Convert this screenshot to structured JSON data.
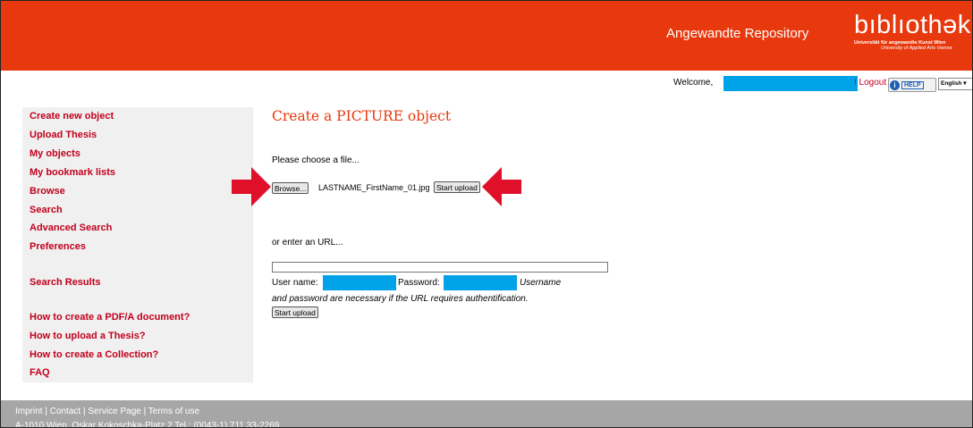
{
  "header": {
    "repository_title": "Angewandte Repository",
    "logo_word": "bıblıothək",
    "logo_sub1": "Universität für angewandte Kunst Wien",
    "logo_sub2": "University of Applied Arts Vienna",
    "brand_color": "#e8390e"
  },
  "userbar": {
    "welcome": "Welcome,",
    "logout": "! Logout",
    "help_label": "HELP",
    "help_icon": "info-icon",
    "language": "English",
    "redaction_color": "#00a2e8"
  },
  "sidebar": {
    "group1": [
      "Create new object",
      "Upload Thesis",
      "My objects",
      "My bookmark lists",
      "Browse",
      "Search",
      "Advanced Search",
      "Preferences"
    ],
    "group2": [
      "Search Results"
    ],
    "group3": [
      "How to create a PDF/A document?",
      "How to upload a Thesis?",
      "How to create a Collection?",
      "FAQ"
    ]
  },
  "main": {
    "title": "Create a PICTURE object",
    "choose_file": "Please choose a file...",
    "browse_button": "Browse...",
    "selected_file": "LASTNAME_FirstName_01.jpg",
    "start_upload_button": "Start upload",
    "enter_url": "or enter an URL...",
    "url_value": "",
    "username_label": "User name:",
    "password_label": "Password:",
    "auth_note_part1": "Username",
    "auth_note_part2": "and password are necessary if the URL requires authentification.",
    "start_upload_button_2": "Start upload",
    "arrow_color": "#e0102a"
  },
  "footer": {
    "links": "Imprint | Contact | Service Page | Terms of use",
    "address": "A-1010 Wien, Oskar Kokoschka-Platz 2 Tel.: (0043-1) 711 33-2269"
  }
}
